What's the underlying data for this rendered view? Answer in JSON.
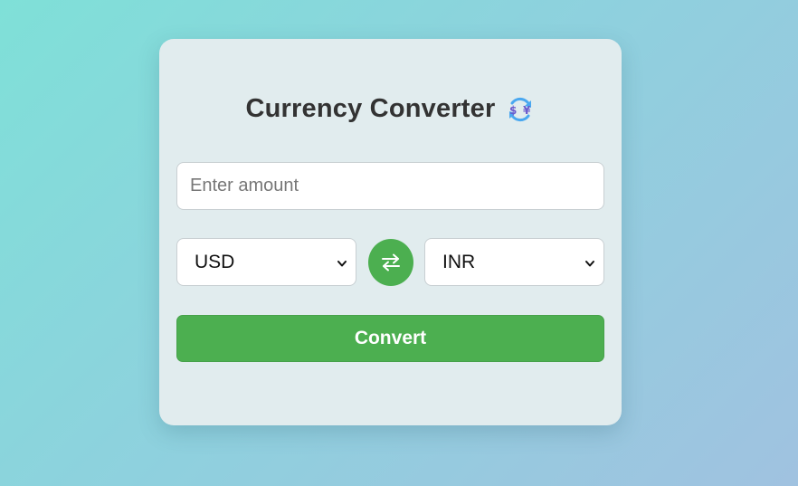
{
  "app": {
    "title": "Currency Converter",
    "title_icon": "currency-exchange-icon"
  },
  "form": {
    "amount": {
      "value": "",
      "placeholder": "Enter amount"
    },
    "from_currency": {
      "selected": "USD",
      "icon": "chevron-down-icon"
    },
    "swap": {
      "icon": "swap-arrows-icon"
    },
    "to_currency": {
      "selected": "INR",
      "icon": "chevron-down-icon"
    },
    "convert_label": "Convert"
  },
  "colors": {
    "accent": "#4caf50",
    "card_bg": "#e1ecee",
    "title_text": "#333333",
    "background_start": "#7fe0d8",
    "background_end": "#a0c2e0"
  }
}
